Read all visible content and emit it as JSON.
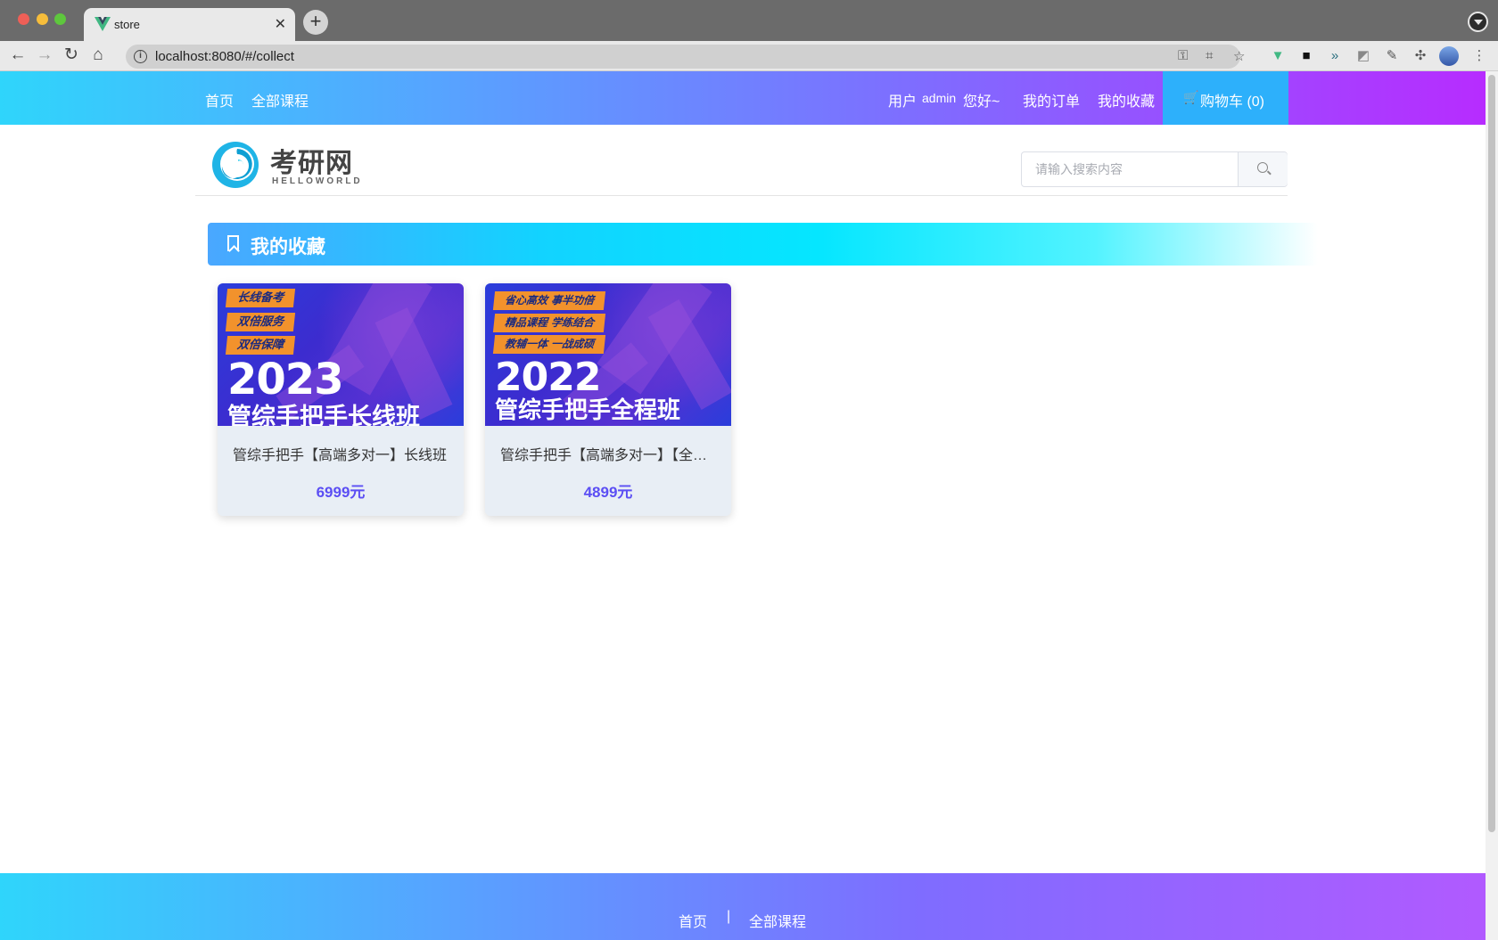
{
  "browser": {
    "tab_title": "store",
    "url": "localhost:8080/#/collect",
    "new_tab_label": "+",
    "close_label": "✕"
  },
  "topnav": {
    "home": "首页",
    "all_courses": "全部课程",
    "greeting_prefix": "用户",
    "username": "admin",
    "greeting_suffix": "您好~",
    "my_orders": "我的订单",
    "my_favorites": "我的收藏",
    "cart": "购物车 (0)"
  },
  "header": {
    "logo_title": "考研网",
    "logo_subtitle": "HELLOWORLD",
    "search_placeholder": "请输入搜索内容"
  },
  "section": {
    "title": "我的收藏"
  },
  "favorites": [
    {
      "image_tags": [
        "长线备考",
        "双倍服务",
        "双倍保障"
      ],
      "image_year": "2023",
      "image_name": "管综手把手长线班",
      "name": "管综手把手【高端多对一】长线班",
      "price": "6999元"
    },
    {
      "image_tags": [
        "省心高效 事半功倍",
        "精品课程 学练结合",
        "教辅一体 一战成硕"
      ],
      "image_year": "2022",
      "image_name": "管综手把手全程班",
      "name": "管综手把手【高端多对一】【全程班】",
      "price": "4899元"
    }
  ],
  "footer": {
    "home": "首页",
    "separator": "|",
    "all_courses": "全部课程"
  },
  "colors": {
    "accent": "#5b4ef4",
    "cart_bg": "#2db0fb"
  }
}
